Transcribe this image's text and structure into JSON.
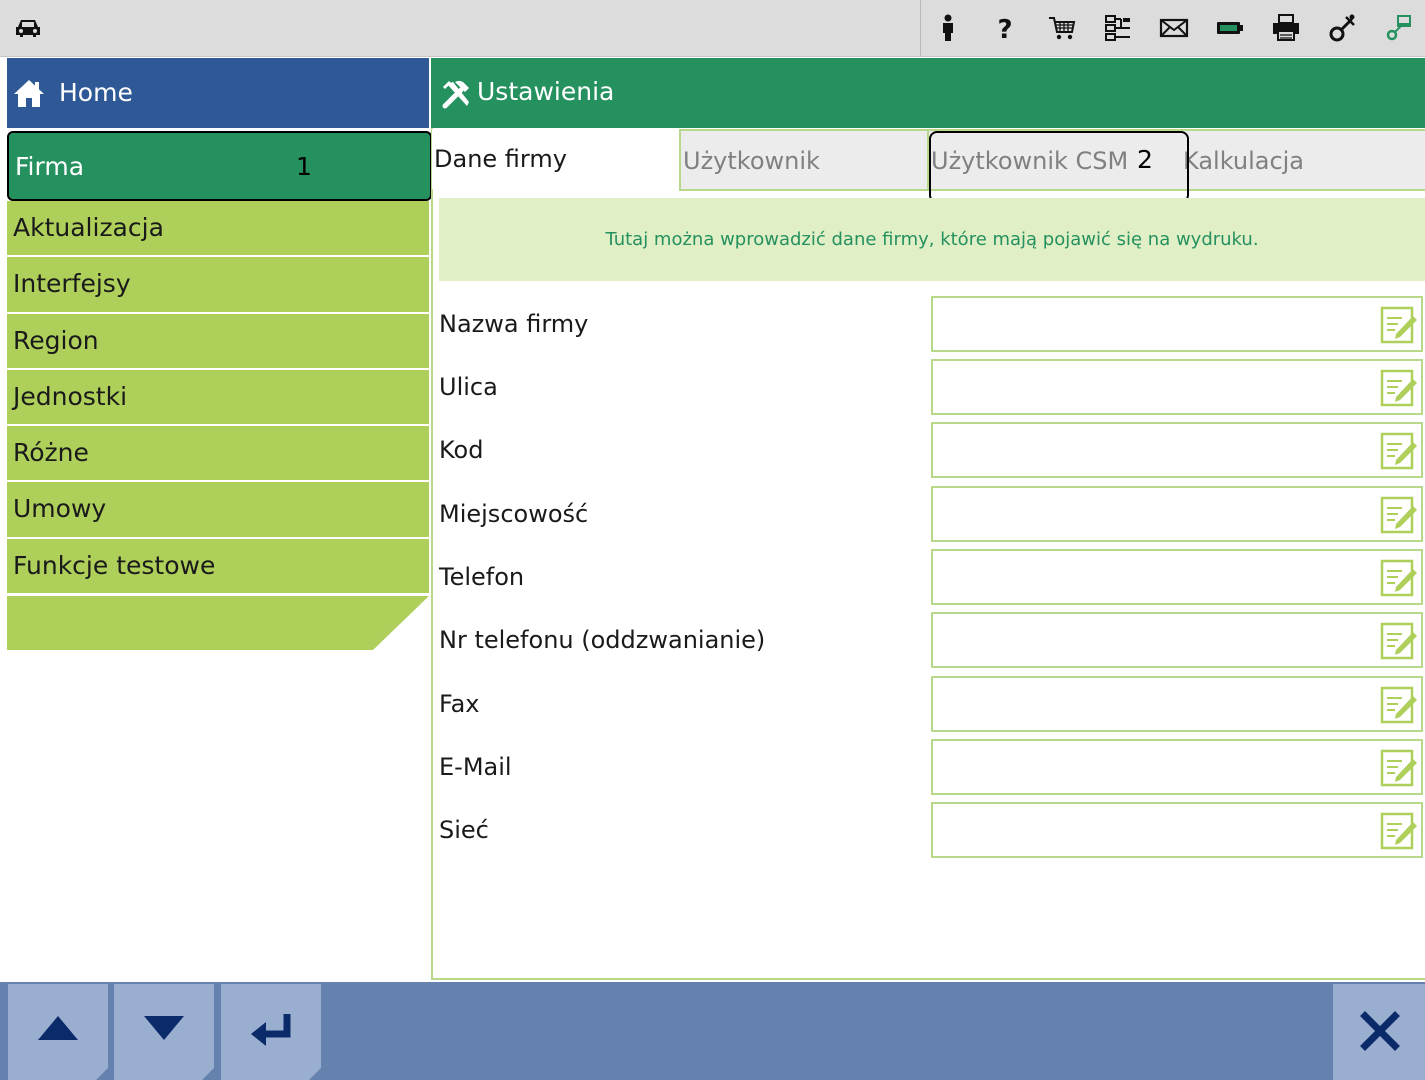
{
  "topbar": {
    "car_icon": "car-icon",
    "icons": [
      "person-icon",
      "help-icon",
      "cart-icon",
      "network-icon",
      "mail-icon",
      "battery-icon",
      "printer-icon",
      "tools-settings-icon",
      "connection-icon"
    ]
  },
  "sidebar": {
    "home_label": "Home",
    "items": [
      {
        "label": "Firma",
        "active": true,
        "callout": "1"
      },
      {
        "label": "Aktualizacja"
      },
      {
        "label": "Interfejsy"
      },
      {
        "label": "Region"
      },
      {
        "label": "Jednostki"
      },
      {
        "label": "Różne"
      },
      {
        "label": "Umowy"
      },
      {
        "label": "Funkcje testowe"
      }
    ]
  },
  "main": {
    "title": "Ustawienia",
    "tabs": [
      {
        "label": "Dane firmy",
        "active": true
      },
      {
        "label": "Użytkownik"
      },
      {
        "label": "Użytkownik CSM",
        "callout": "2"
      },
      {
        "label": "Kalkulacja"
      }
    ],
    "info": "Tutaj można wprowadzić dane firmy, które mają pojawić się na wydruku.",
    "fields": [
      {
        "label": "Nazwa firmy",
        "value": ""
      },
      {
        "label": "Ulica",
        "value": ""
      },
      {
        "label": "Kod",
        "value": ""
      },
      {
        "label": "Miejscowość",
        "value": ""
      },
      {
        "label": "Telefon",
        "value": ""
      },
      {
        "label": "Nr telefonu (oddzwanianie)",
        "value": ""
      },
      {
        "label": "Fax",
        "value": ""
      },
      {
        "label": "E-Mail",
        "value": ""
      },
      {
        "label": "Sieć",
        "value": ""
      }
    ]
  },
  "bottombar": {
    "buttons": [
      "arrow-up-icon",
      "arrow-down-icon",
      "enter-icon",
      "close-icon"
    ]
  },
  "colors": {
    "header_blue": "#2f5996",
    "header_green": "#25915f",
    "sidebar_green": "#aecf5a",
    "bottombar_blue": "#6582ae",
    "button_blue": "#9aaed0"
  }
}
